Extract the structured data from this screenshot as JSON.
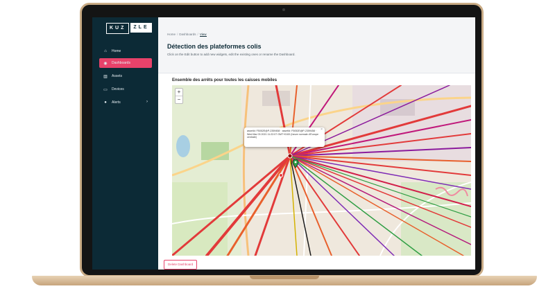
{
  "app": {
    "logo_left": "KUZ",
    "logo_right": "ZLE"
  },
  "sidebar": {
    "items": [
      {
        "label": "Home",
        "icon": "home-icon",
        "glyph": "⌂",
        "active": false
      },
      {
        "label": "Dashboards",
        "icon": "dashboard-icon",
        "glyph": "◉",
        "active": true
      },
      {
        "label": "Assets",
        "icon": "assets-icon",
        "glyph": "▥",
        "active": false
      },
      {
        "label": "Devices",
        "icon": "devices-icon",
        "glyph": "▭",
        "active": false
      },
      {
        "label": "Alerts",
        "icon": "alert-icon",
        "glyph": "●",
        "active": false
      }
    ],
    "chevron": "›"
  },
  "header": {
    "breadcrumb": [
      "Home",
      "Dashboards",
      "View"
    ],
    "breadcrumb_sep": "/",
    "title": "Détection des plateformes colis",
    "subtitle": "Click on the Edit button to add new widgets, edit the existing ones or rename the Dashboard."
  },
  "widget": {
    "title": "Ensemble des arrêts pour toutes les caisses mobiles",
    "zoom_in": "+",
    "zoom_out": "−",
    "popup_text": "assetId: F5052E@P-2359458 · assetId: F5052E@P-2359458 · Wed Mar 03 2021 11:22:07 GMT+0100 (heure normale d'Europe centrale)",
    "popup_close": "×"
  },
  "footer": {
    "delete_label": "Delete Dashboard"
  },
  "colors": {
    "sidebar_bg": "#0c2a36",
    "accent": "#e8426a"
  }
}
